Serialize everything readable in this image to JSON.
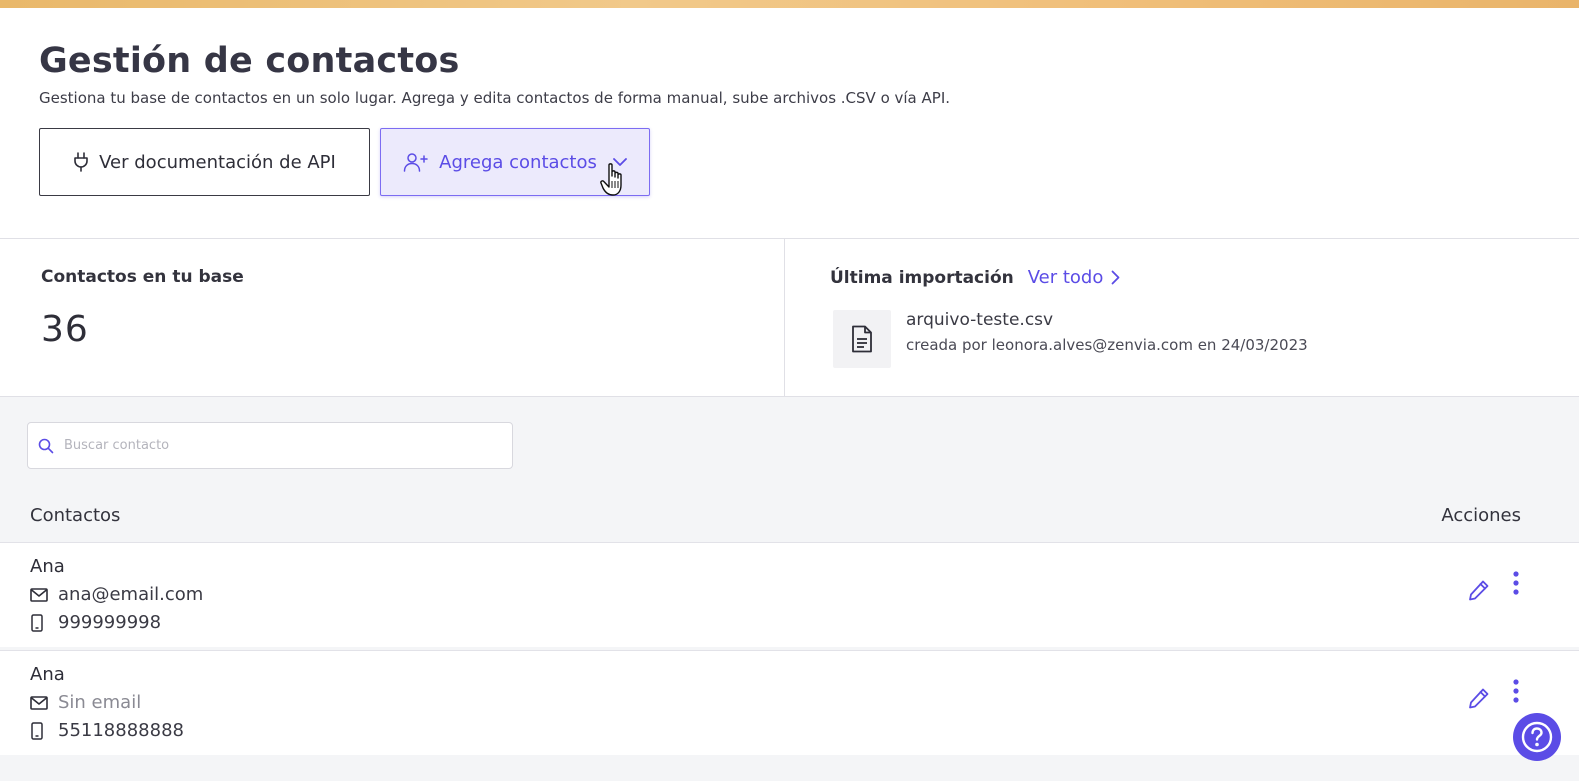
{
  "header": {
    "title": "Gestión de contactos",
    "subtitle": "Gestiona tu base de contactos en un solo lugar. Agrega y edita contactos de forma manual, sube archivos .CSV o vía API."
  },
  "actions": {
    "api_docs_label": "Ver documentación de API",
    "add_contacts_label": "Agrega contactos"
  },
  "stats": {
    "contacts_label": "Contactos en tu base",
    "contacts_count": "36"
  },
  "last_import": {
    "title": "Última importación",
    "view_all_label": "Ver todo",
    "file_name": "arquivo-teste.csv",
    "file_meta": "creada por leonora.alves@zenvia.com en 24/03/2023"
  },
  "search": {
    "placeholder": "Buscar contacto"
  },
  "table": {
    "col_contacts": "Contactos",
    "col_actions": "Acciones",
    "rows": [
      {
        "name": "Ana",
        "email": "ana@email.com",
        "phone": "999999998"
      },
      {
        "name": "Ana",
        "email": "Sin email",
        "phone": "55118888888"
      }
    ]
  },
  "colors": {
    "accent": "#5b4ce6",
    "top_bar": "#f0c07c",
    "list_bg": "#f4f5f7"
  },
  "icons": {
    "api_button": "plug-icon",
    "add_button": "user-plus-icon",
    "dropdown": "chevron-down-icon",
    "view_all": "chevron-right-icon",
    "file": "file-text-icon",
    "search": "search-icon",
    "email": "mail-icon",
    "phone": "mobile-icon",
    "edit": "pencil-icon",
    "more": "more-vertical-icon",
    "help": "help-circle-icon"
  }
}
